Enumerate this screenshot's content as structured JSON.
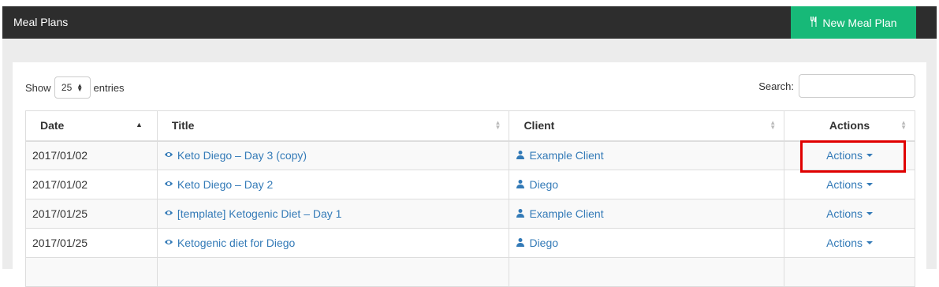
{
  "header": {
    "title": "Meal Plans",
    "new_button_label": "New Meal Plan"
  },
  "controls": {
    "show_label": "Show",
    "entries_value": "25",
    "entries_label": "entries",
    "search_label": "Search:",
    "search_value": ""
  },
  "table": {
    "columns": [
      "Date",
      "Title",
      "Client",
      "Actions"
    ],
    "rows": [
      {
        "date": "2017/01/02",
        "title": "Keto Diego – Day 3 (copy)",
        "client": "Example Client",
        "action": "Actions"
      },
      {
        "date": "2017/01/02",
        "title": "Keto Diego – Day 2",
        "client": "Diego",
        "action": "Actions"
      },
      {
        "date": "2017/01/25",
        "title": "[template] Ketogenic Diet – Day 1",
        "client": "Example Client",
        "action": "Actions"
      },
      {
        "date": "2017/01/25",
        "title": "Ketogenic diet for Diego",
        "client": "Diego",
        "action": "Actions"
      }
    ]
  },
  "colors": {
    "accent_green": "#17b978",
    "link_blue": "#337ab7",
    "topbar": "#2d2d2d",
    "highlight_red": "#e00000"
  }
}
